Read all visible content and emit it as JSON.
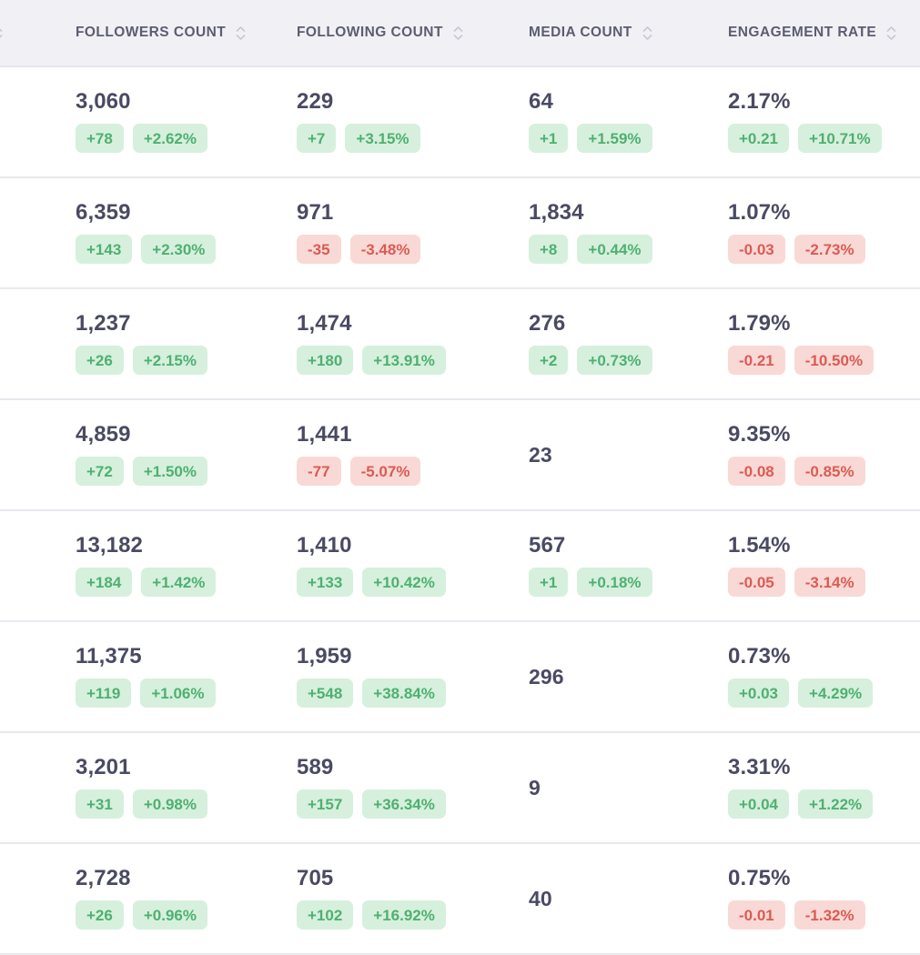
{
  "table": {
    "columns": [
      {
        "id": "lead",
        "label": "",
        "sortable": true,
        "truncated": true
      },
      {
        "id": "followers_count",
        "label": "FOLLOWERS COUNT",
        "sortable": true
      },
      {
        "id": "following_count",
        "label": "FOLLOWING COUNT",
        "sortable": true
      },
      {
        "id": "media_count",
        "label": "MEDIA COUNT",
        "sortable": true
      },
      {
        "id": "engagement_rate",
        "label": "ENGAGEMENT RATE",
        "sortable": true
      }
    ],
    "sort_icon": "sort-chevrons-icon",
    "colors": {
      "header_background": "#f1f1f5",
      "header_text": "#5c5c72",
      "row_background": "#ffffff",
      "row_divider": "#e8e8ee",
      "value_text": "#4a4a63",
      "badge_up_background": "#d6f0dd",
      "badge_up_text": "#4fb071",
      "badge_down_background": "#f9d9d6",
      "badge_down_text": "#db5b53"
    },
    "rows": [
      {
        "followers_count": {
          "value": "3,060",
          "delta_abs": "+78",
          "delta_pct": "+2.62%",
          "direction": "up"
        },
        "following_count": {
          "value": "229",
          "delta_abs": "+7",
          "delta_pct": "+3.15%",
          "direction": "up"
        },
        "media_count": {
          "value": "64",
          "delta_abs": "+1",
          "delta_pct": "+1.59%",
          "direction": "up"
        },
        "engagement_rate": {
          "value": "2.17%",
          "delta_abs": "+0.21",
          "delta_pct": "+10.71%",
          "direction": "up"
        }
      },
      {
        "followers_count": {
          "value": "6,359",
          "delta_abs": "+143",
          "delta_pct": "+2.30%",
          "direction": "up"
        },
        "following_count": {
          "value": "971",
          "delta_abs": "-35",
          "delta_pct": "-3.48%",
          "direction": "down"
        },
        "media_count": {
          "value": "1,834",
          "delta_abs": "+8",
          "delta_pct": "+0.44%",
          "direction": "up"
        },
        "engagement_rate": {
          "value": "1.07%",
          "delta_abs": "-0.03",
          "delta_pct": "-2.73%",
          "direction": "down"
        }
      },
      {
        "followers_count": {
          "value": "1,237",
          "delta_abs": "+26",
          "delta_pct": "+2.15%",
          "direction": "up"
        },
        "following_count": {
          "value": "1,474",
          "delta_abs": "+180",
          "delta_pct": "+13.91%",
          "direction": "up"
        },
        "media_count": {
          "value": "276",
          "delta_abs": "+2",
          "delta_pct": "+0.73%",
          "direction": "up"
        },
        "engagement_rate": {
          "value": "1.79%",
          "delta_abs": "-0.21",
          "delta_pct": "-10.50%",
          "direction": "down"
        }
      },
      {
        "followers_count": {
          "value": "4,859",
          "delta_abs": "+72",
          "delta_pct": "+1.50%",
          "direction": "up"
        },
        "following_count": {
          "value": "1,441",
          "delta_abs": "-77",
          "delta_pct": "-5.07%",
          "direction": "down"
        },
        "media_count": {
          "value": "23",
          "delta_abs": null,
          "delta_pct": null,
          "direction": null
        },
        "engagement_rate": {
          "value": "9.35%",
          "delta_abs": "-0.08",
          "delta_pct": "-0.85%",
          "direction": "down"
        }
      },
      {
        "followers_count": {
          "value": "13,182",
          "delta_abs": "+184",
          "delta_pct": "+1.42%",
          "direction": "up"
        },
        "following_count": {
          "value": "1,410",
          "delta_abs": "+133",
          "delta_pct": "+10.42%",
          "direction": "up"
        },
        "media_count": {
          "value": "567",
          "delta_abs": "+1",
          "delta_pct": "+0.18%",
          "direction": "up"
        },
        "engagement_rate": {
          "value": "1.54%",
          "delta_abs": "-0.05",
          "delta_pct": "-3.14%",
          "direction": "down"
        }
      },
      {
        "followers_count": {
          "value": "11,375",
          "delta_abs": "+119",
          "delta_pct": "+1.06%",
          "direction": "up"
        },
        "following_count": {
          "value": "1,959",
          "delta_abs": "+548",
          "delta_pct": "+38.84%",
          "direction": "up"
        },
        "media_count": {
          "value": "296",
          "delta_abs": null,
          "delta_pct": null,
          "direction": null
        },
        "engagement_rate": {
          "value": "0.73%",
          "delta_abs": "+0.03",
          "delta_pct": "+4.29%",
          "direction": "up"
        }
      },
      {
        "followers_count": {
          "value": "3,201",
          "delta_abs": "+31",
          "delta_pct": "+0.98%",
          "direction": "up"
        },
        "following_count": {
          "value": "589",
          "delta_abs": "+157",
          "delta_pct": "+36.34%",
          "direction": "up"
        },
        "media_count": {
          "value": "9",
          "delta_abs": null,
          "delta_pct": null,
          "direction": null
        },
        "engagement_rate": {
          "value": "3.31%",
          "delta_abs": "+0.04",
          "delta_pct": "+1.22%",
          "direction": "up"
        }
      },
      {
        "followers_count": {
          "value": "2,728",
          "delta_abs": "+26",
          "delta_pct": "+0.96%",
          "direction": "up"
        },
        "following_count": {
          "value": "705",
          "delta_abs": "+102",
          "delta_pct": "+16.92%",
          "direction": "up"
        },
        "media_count": {
          "value": "40",
          "delta_abs": null,
          "delta_pct": null,
          "direction": null
        },
        "engagement_rate": {
          "value": "0.75%",
          "delta_abs": "-0.01",
          "delta_pct": "-1.32%",
          "direction": "down"
        }
      }
    ]
  }
}
